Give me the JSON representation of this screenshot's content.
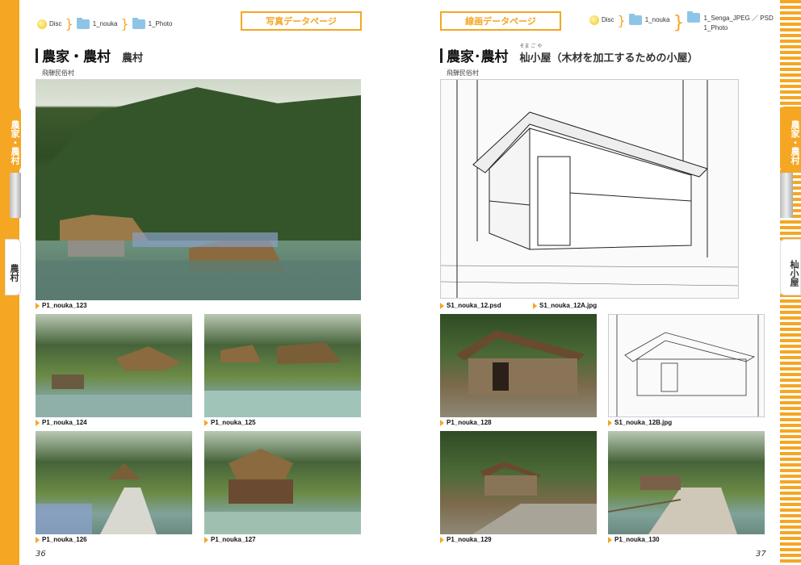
{
  "left_page": {
    "breadcrumb": [
      "Disc",
      "1_nouka",
      "1_Photo"
    ],
    "page_label": "写真データページ",
    "heading_main": "農家・農村",
    "heading_sub": "農村",
    "location": "飛騨民俗村",
    "side_tab_active": "農家・農村",
    "side_tab_sub": "農村",
    "photos": [
      "P1_nouka_123",
      "P1_nouka_124",
      "P1_nouka_125",
      "P1_nouka_126",
      "P1_nouka_127"
    ],
    "page_number": "36"
  },
  "right_page": {
    "breadcrumb": [
      "Disc",
      "1_nouka",
      "1_Senga_JPEG ／ PSD",
      "1_Photo"
    ],
    "page_label": "線画データページ",
    "heading_main": "農家･農村",
    "heading_sub_title": "杣小屋",
    "heading_sub_ruby": "そま ご や",
    "heading_sub_desc": "（木材を加工するための小屋）",
    "location": "飛騨民俗村",
    "side_tab_active": "農家・農村",
    "side_tab_sub": "杣小屋",
    "main_captions": [
      "S1_nouka_12.psd",
      "S1_nouka_12A.jpg"
    ],
    "photos": [
      "P1_nouka_128",
      "S1_nouka_12B.jpg",
      "P1_nouka_129",
      "P1_nouka_130"
    ],
    "page_number": "37"
  },
  "colors": {
    "accent": "#f5a623",
    "folder": "#8ec5e6",
    "disc": "#f2c418"
  }
}
